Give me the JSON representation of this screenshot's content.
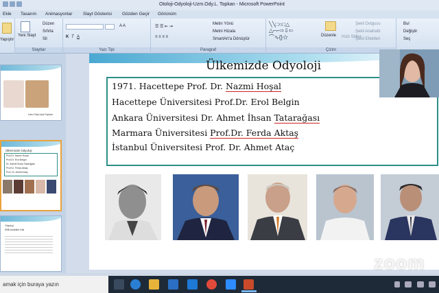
{
  "window": {
    "title": "Otoloji-Odyoloji-Uzm.Ody.L. Topkan - Microsoft PowerPoint"
  },
  "menu": [
    "Ekle",
    "Tasarım",
    "Animasyonlar",
    "Slayt Gösterisi",
    "Gözden Geçir",
    "Görünüm"
  ],
  "ribbon": {
    "clipboard": {
      "label": "Düzen",
      "paste": "Yapıştır",
      "group": "Slaytlar"
    },
    "slides": {
      "new_slide": "Yeni Slayt",
      "layout": "Düzen",
      "reset": "Sıfırla",
      "delete": "Sil"
    },
    "font_group": "Yazı Tipi",
    "paragraph_group": "Paragraf",
    "paragraph": {
      "text_direction": "Metin Yönü",
      "align_text": "Metni Hizala",
      "smartart": "SmartArt'a Dönüştür"
    },
    "drawing_group": "Çizim",
    "drawing": {
      "arrange": "Düzenle",
      "quick_styles": "Hızlı Stiller",
      "fill": "Şekil Dolgusu",
      "outline": "Şekil Anahattı",
      "effects": "Şekil Efektleri"
    },
    "editing": {
      "find": "Bul",
      "replace": "Değiştir",
      "select": "Seç"
    }
  },
  "thumbnails": {
    "t1_caption": "Uzm.Ody.Leyla Topkan",
    "t2_title": "Ülkemizde Odyoloji",
    "t2_lines": [
      "Prof.Dr. Nazmi Hoşal",
      "Prof.Dr. Erol Belgin",
      "Dr. Ahmet İhsan Tatarağası",
      "Prof.Dr. Ferda Aktaş",
      "Prof. Dr. Ahmet Ataç"
    ],
    "t3_lines": [
      "Odyoloji",
      "KBB Anabilim Dalı"
    ]
  },
  "slide": {
    "title": "Ülkemizde Odyoloji",
    "lines": [
      {
        "pre": "1971. Hacettepe Prof. Dr. ",
        "u": "Nazmi Hoşal",
        "post": ""
      },
      {
        "pre": "Hacettepe Üniversitesi Prof.Dr. Erol Belgin",
        "u": "",
        "post": ""
      },
      {
        "pre": "Ankara Üniversitesi  Dr. Ahmet İhsan ",
        "u": "Tatarağası",
        "post": ""
      },
      {
        "pre": "Marmara Üniversitesi ",
        "u": "Prof.Dr. Ferda Aktaş",
        "post": ""
      },
      {
        "pre": "İstanbul Üniversitesi Prof. Dr. Ahmet Ataç",
        "u": "",
        "post": ""
      }
    ]
  },
  "taskbar": {
    "search_placeholder": "amak için buraya yazın"
  },
  "overlay": {
    "watermark": "zoom"
  },
  "colors": {
    "accent": "#2c8f86",
    "ribbon": "#d3e0ef",
    "taskbar": "#1f2a38"
  }
}
